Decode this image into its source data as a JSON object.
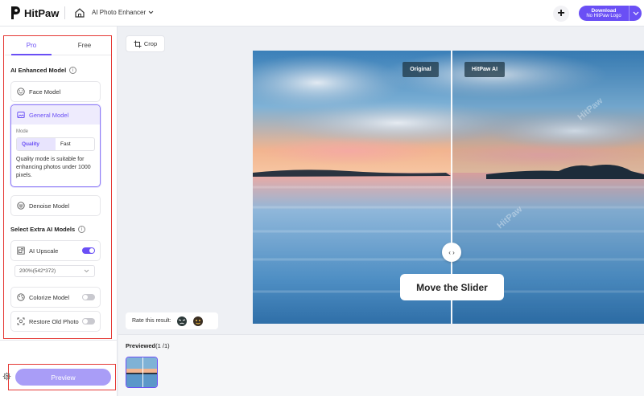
{
  "app": {
    "brand": "HitPaw",
    "title": "AI Photo Enhancer",
    "download_label": "Download",
    "download_sublabel": "No HitPaw Logo"
  },
  "sidebar": {
    "tabs": [
      {
        "label": "Pro",
        "active": true
      },
      {
        "label": "Free",
        "active": false
      }
    ],
    "ai_models_title": "AI Enhanced Model",
    "models": {
      "face": "Face Model",
      "general": "General Model",
      "denoise": "Denoise Model"
    },
    "mode_label": "Mode",
    "modes": {
      "quality": "Quality",
      "fast": "Fast"
    },
    "mode_description": "Quality mode is suitable for enhancing photos under 1000 pixels.",
    "extra_title": "Select Extra AI Models",
    "upscale_label": "AI Upscale",
    "upscale_enabled": true,
    "upscale_option": "200%(542*372)",
    "colorize_label": "Colorize Model",
    "colorize_enabled": false,
    "restore_label": "Restore Old Photo",
    "restore_enabled": false,
    "preview_label": "Preview"
  },
  "workspace": {
    "crop_label": "Crop",
    "original_badge": "Original",
    "ai_badge": "HitPaw AI",
    "watermark": "HitPaw",
    "slider_knob": "‹ ›",
    "slider_hint": "Move the Slider",
    "rate_label": "Rate this result:",
    "previewed_label": "Previewed",
    "previewed_count": "(1 /1)"
  },
  "colors": {
    "accent": "#6a4ff5",
    "highlight_box": "#e53935"
  }
}
